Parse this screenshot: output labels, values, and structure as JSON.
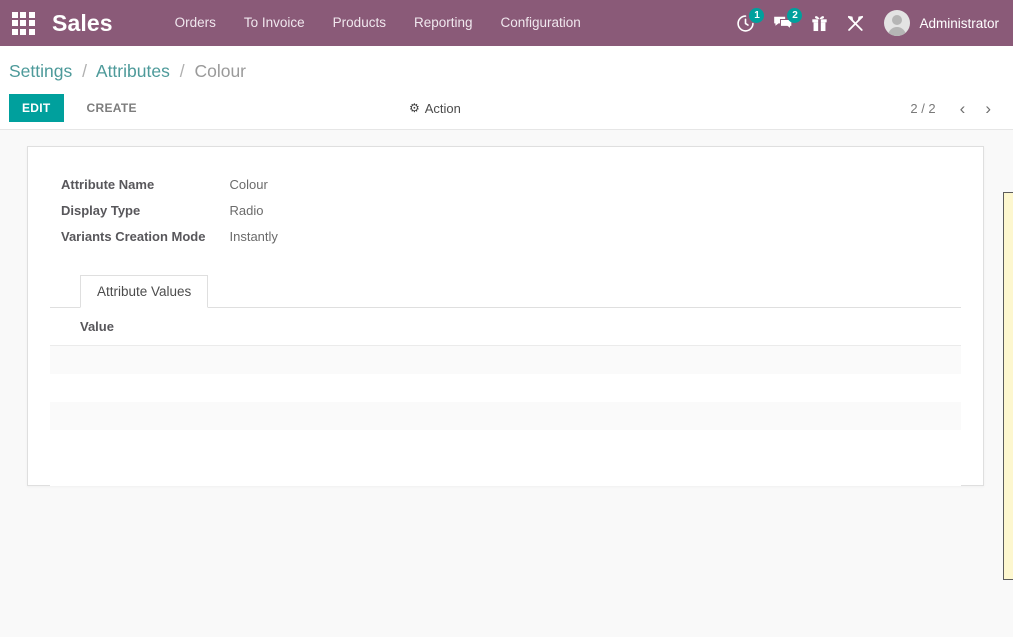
{
  "navbar": {
    "apps_icon": "grid-apps-icon",
    "brand": "Sales",
    "menu_items": [
      {
        "label": "Orders"
      },
      {
        "label": "To Invoice"
      },
      {
        "label": "Products"
      },
      {
        "label": "Reporting"
      },
      {
        "label": "Configuration"
      }
    ],
    "icons": [
      {
        "name": "activity-clock-icon",
        "badge": "1"
      },
      {
        "name": "messages-icon",
        "badge": "2"
      },
      {
        "name": "gift-icon",
        "badge": ""
      },
      {
        "name": "tools-wrench-icon",
        "badge": ""
      }
    ],
    "user": {
      "name": "Administrator",
      "avatar": "user-avatar"
    },
    "colors": {
      "background": "#8a5a78",
      "badge": "#00a09d",
      "text": "#ffffff"
    }
  },
  "control_panel": {
    "breadcrumb": [
      {
        "label": "Settings",
        "active": false
      },
      {
        "label": "Attributes",
        "active": false
      },
      {
        "label": "Colour",
        "active": true
      }
    ],
    "separator": "/",
    "buttons": {
      "edit_label": "EDIT",
      "create_label": "CREATE"
    },
    "action_menu": {
      "icon": "gear-icon",
      "glyph": "⚙",
      "label": "Action"
    },
    "pager": {
      "count": "2 / 2",
      "previous_glyph": "‹",
      "next_glyph": "›"
    },
    "colors": {
      "edit_button": "#00a09d",
      "breadcrumb_link": "#4d9a9a",
      "breadcrumb_active": "#9a9a9a"
    }
  },
  "form": {
    "fields": [
      {
        "label": "Attribute Name",
        "value": "Colour"
      },
      {
        "label": "Display Type",
        "value": "Radio"
      },
      {
        "label": "Variants Creation Mode",
        "value": "Instantly"
      }
    ],
    "notebook": {
      "tabs": [
        {
          "label": "Attribute Values",
          "active": true
        }
      ],
      "list": {
        "columns": [
          "Value"
        ],
        "rows": []
      }
    }
  },
  "side_panel": {
    "name": "right-slide-panel",
    "color": "#fdf7cf"
  }
}
